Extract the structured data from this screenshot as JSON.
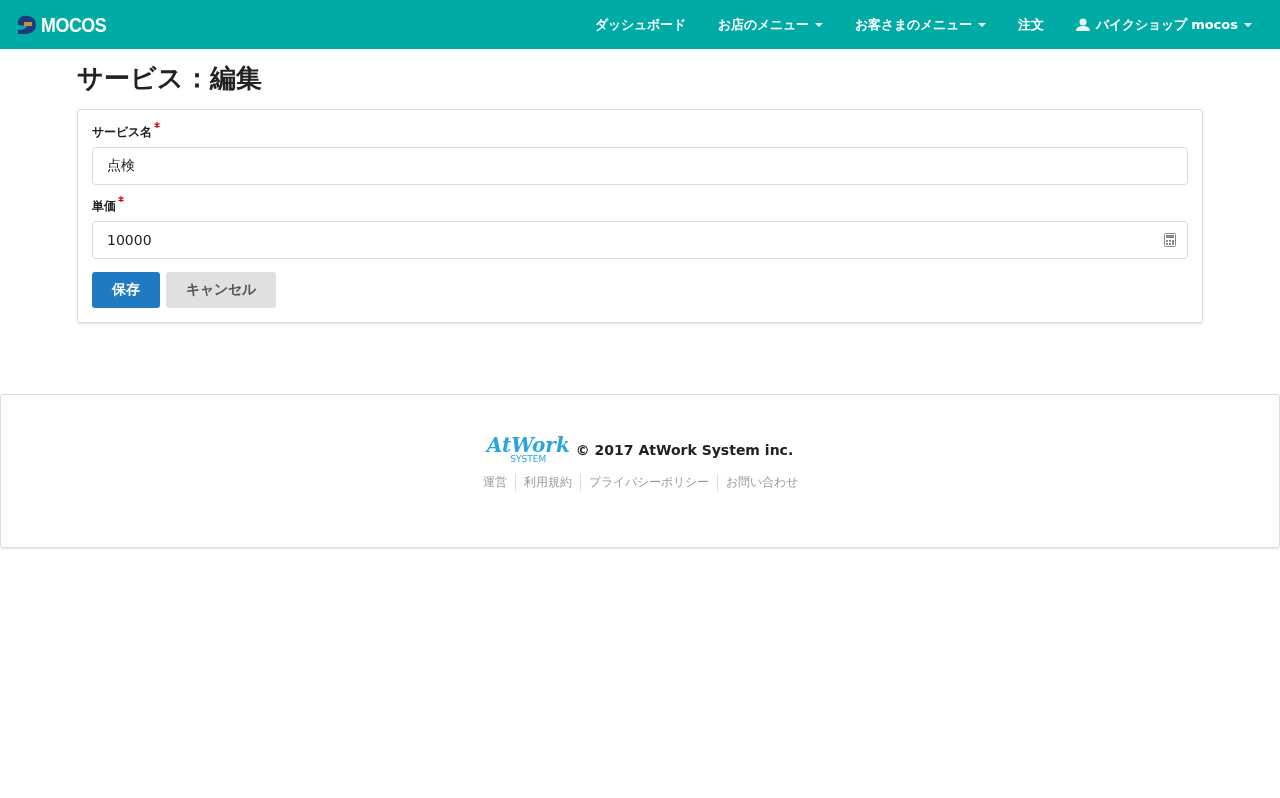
{
  "navbar": {
    "brand": "MOCOS",
    "items": [
      {
        "label": "ダッシュボード",
        "dropdown": false
      },
      {
        "label": "お店のメニュー",
        "dropdown": true
      },
      {
        "label": "お客さまのメニュー",
        "dropdown": true
      },
      {
        "label": "注文",
        "dropdown": false
      },
      {
        "label": "バイクショップ mocos",
        "dropdown": true,
        "kind": "user"
      }
    ]
  },
  "page_title": "サービス：編集",
  "form": {
    "fields": [
      {
        "label": "サービス名",
        "required": true,
        "value": "点検",
        "kind": "text"
      },
      {
        "label": "単価",
        "required": true,
        "value": "10000",
        "kind": "number"
      }
    ],
    "buttons": [
      {
        "label": "保存",
        "kind": "primary"
      },
      {
        "label": "キャンセル",
        "kind": "default"
      }
    ]
  },
  "footer": {
    "logo_text": "AtWork",
    "logo_sub": "SYSTEM",
    "copyright": "© 2017 AtWork System inc.",
    "links": [
      "運営",
      "利用規約",
      "プライバシーポリシー",
      "お問い合わせ"
    ]
  }
}
